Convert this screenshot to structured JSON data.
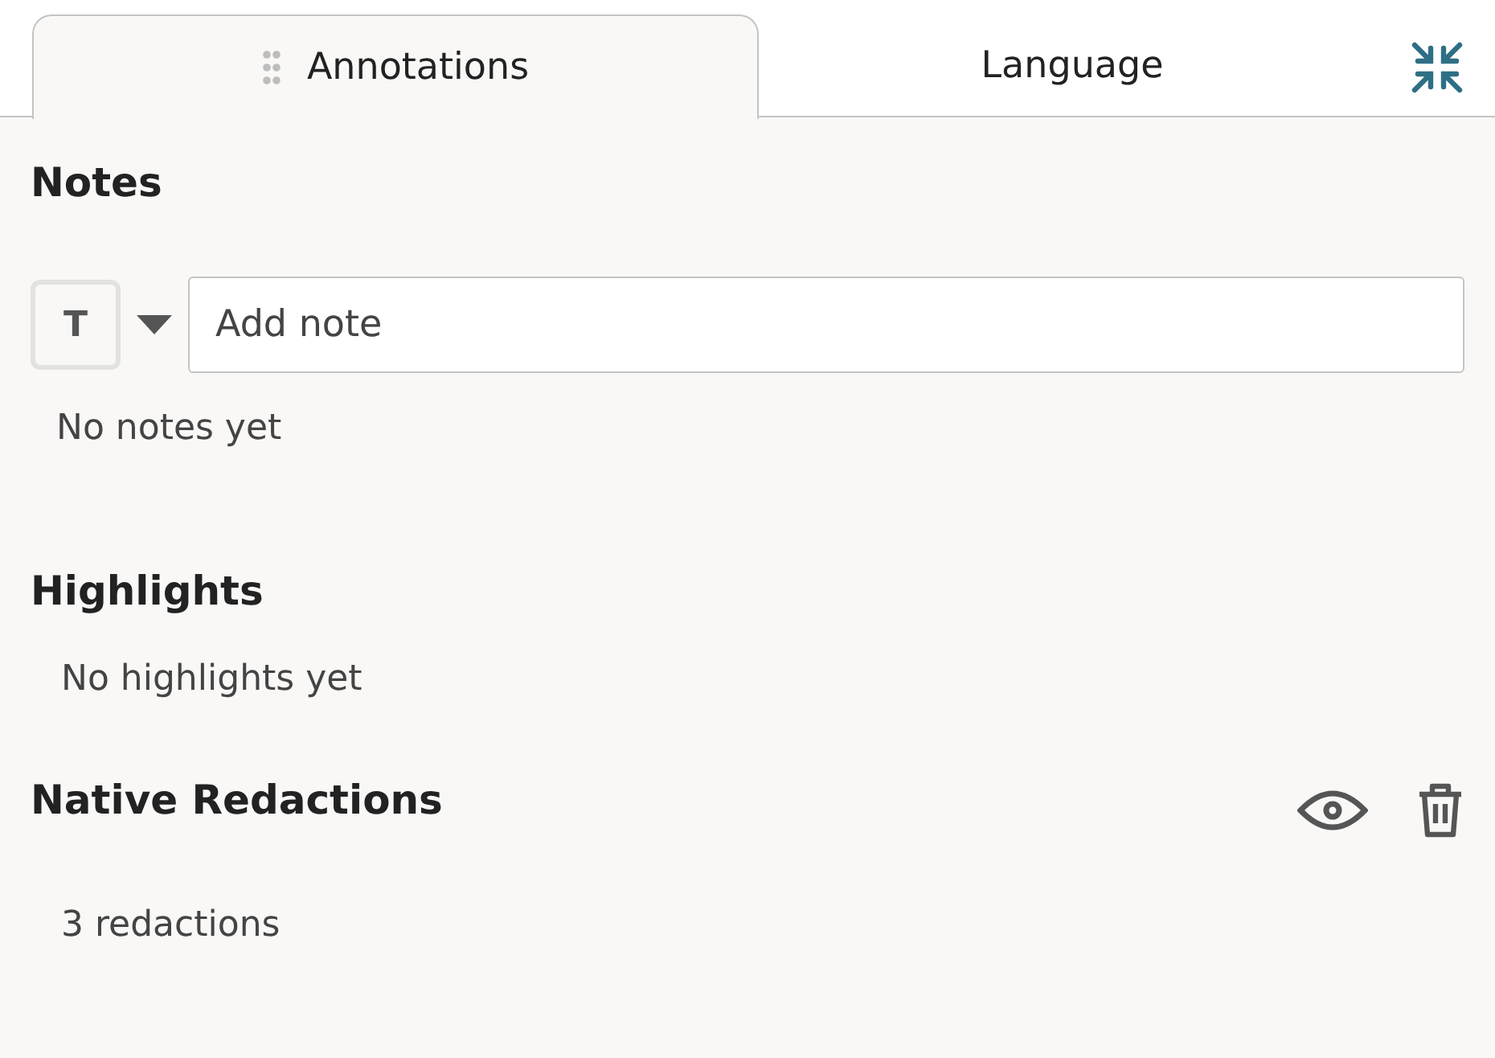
{
  "tabs": [
    {
      "label": "Annotations",
      "selected": true,
      "draggable": true
    },
    {
      "label": "Language",
      "selected": false,
      "draggable": false
    }
  ],
  "notes": {
    "title": "Notes",
    "type_button": "T",
    "input": {
      "placeholder": "Add note"
    },
    "empty": "No notes yet"
  },
  "highlights": {
    "title": "Highlights",
    "empty": "No highlights yet"
  },
  "redactions": {
    "title": "Native Redactions",
    "count": "3 redactions"
  }
}
